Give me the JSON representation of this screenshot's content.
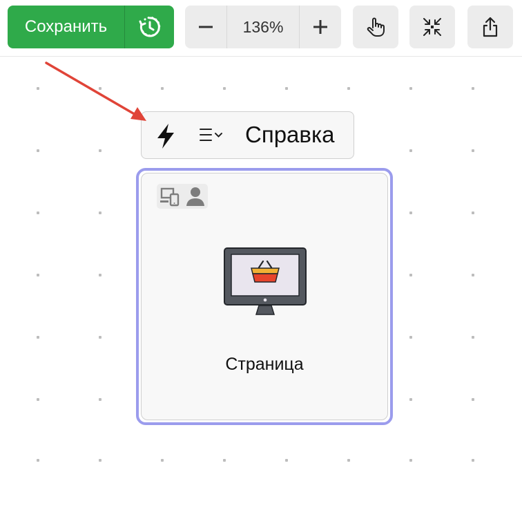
{
  "toolbar": {
    "save_label": "Сохранить",
    "zoom_value": "136%"
  },
  "node": {
    "label": "Справка",
    "title": "Страница"
  },
  "colors": {
    "save_green": "#2faa4a",
    "node_border": "#9b9ced",
    "annotation_arrow": "#e04438"
  }
}
